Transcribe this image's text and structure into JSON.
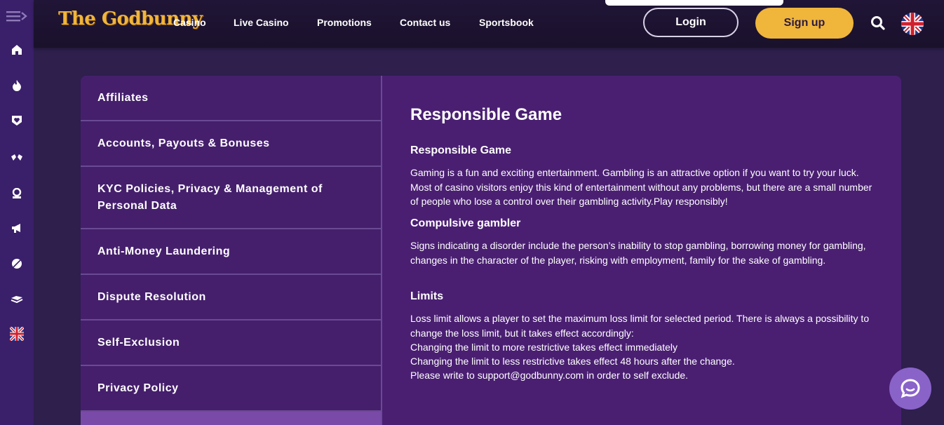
{
  "brand": {
    "logo_text": "The Godbunny"
  },
  "nav": {
    "items": [
      {
        "label": "Casino"
      },
      {
        "label": "Live Casino"
      },
      {
        "label": "Promotions"
      },
      {
        "label": "Contact us"
      },
      {
        "label": "Sportsbook"
      }
    ]
  },
  "header": {
    "login_label": "Login",
    "signup_label": "Sign up"
  },
  "sidebar_icons": [
    "menu-icon",
    "home-icon",
    "fire-icon",
    "shield-heart-icon",
    "gamepad-icon",
    "dealer-icon",
    "megaphone-icon",
    "ball-icon",
    "sportsbook-icon",
    "flag-uk-icon"
  ],
  "info_menu": {
    "items": [
      {
        "label": "Affiliates"
      },
      {
        "label": "Accounts, Payouts & Bonuses"
      },
      {
        "label": "KYC Policies, Privacy & Management of Personal Data"
      },
      {
        "label": "Anti-Money Laundering"
      },
      {
        "label": "Dispute Resolution"
      },
      {
        "label": "Self-Exclusion"
      },
      {
        "label": "Privacy Policy"
      },
      {
        "label": ""
      }
    ],
    "active_index": 7
  },
  "article": {
    "title": "Responsible Game",
    "sections": [
      {
        "heading": "Responsible Game",
        "body": "Gaming is a fun and exciting entertainment. Gambling is an attractive option if you want to try your luck. Most of casino visitors enjoy this kind of entertainment without any problems, but there are a small number of people who lose a control over their gambling activity.Play responsibly!"
      },
      {
        "heading": "Compulsive gambler",
        "body": "Signs indicating a disorder include the person’s inability to stop gambling, borrowing money for gambling, changes in the character of the player, risking with employment, family for the sake of gambling."
      },
      {
        "heading": "Limits",
        "lines": [
          "Loss limit allows a player to set the maximum loss limit for selected period. There is always a possibility to change the loss limit, but it takes effect accordingly:",
          "Changing the limit to more restrictive takes effect immediately",
          "Changing the limit to less restrictive takes effect 48 hours after the change.",
          "Please write to support@godbunny.com in order to self exclude."
        ]
      }
    ]
  },
  "colors": {
    "accent": "#f0b53b",
    "panel_bg": "#4a1f72",
    "rail_bg": "#3a1f6a",
    "active_menu": "#7a4aa8",
    "chat_bubble": "#8a63c9"
  }
}
